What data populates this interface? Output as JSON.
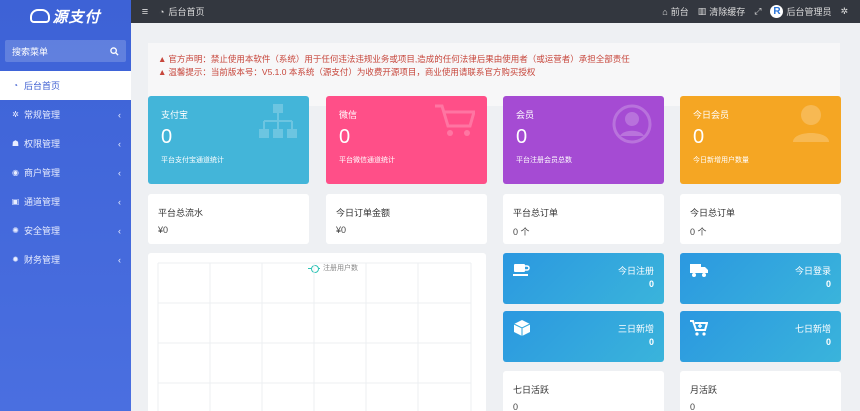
{
  "logo": {
    "text": "源支付"
  },
  "sidebar": {
    "search_label": "搜索菜单",
    "items": [
      {
        "label": "后台首页",
        "icon": "dashboard-icon",
        "active": true
      },
      {
        "label": "常规管理",
        "icon": "cogs-icon"
      },
      {
        "label": "权限管理",
        "icon": "users-icon"
      },
      {
        "label": "商户管理",
        "icon": "user-circle-icon"
      },
      {
        "label": "通道管理",
        "icon": "channel-icon"
      },
      {
        "label": "安全管理",
        "icon": "gear-icon"
      },
      {
        "label": "财务管理",
        "icon": "finance-icon"
      }
    ]
  },
  "topbar": {
    "breadcrumb": "后台首页",
    "front_label": "前台",
    "clear_cache_label": "清除缓存",
    "admin_label": "后台管理员",
    "avatar_letter": "R"
  },
  "notice": {
    "line1": "官方声明：禁止使用本软件（系统）用于任何违法违规业务或项目,造成的任何法律后果由使用者（或运营者）承担全部责任",
    "line2": "温馨提示：当前版本号：V5.1.0 本系统（源支付）为收费开源项目，商业使用请联系官方购买授权"
  },
  "cards": [
    {
      "title": "支付宝",
      "value": "0",
      "desc": "平台支付宝通道统计",
      "color": "#43b5d9",
      "icon": "sitemap-icon"
    },
    {
      "title": "微信",
      "value": "0",
      "desc": "平台微信通道统计",
      "color": "#ff4f88",
      "icon": "cart-icon"
    },
    {
      "title": "会员",
      "value": "0",
      "desc": "平台注册会员总数",
      "color": "#a54bd3",
      "icon": "user-icon"
    },
    {
      "title": "今日会员",
      "value": "0",
      "desc": "今日新增用户数量",
      "color": "#f5a623",
      "icon": "user-icon"
    }
  ],
  "stats": [
    {
      "label": "平台总流水",
      "value": "¥0"
    },
    {
      "label": "今日订单金额",
      "value": "¥0"
    },
    {
      "label": "平台总订单",
      "value": "0 个"
    },
    {
      "label": "今日总订单",
      "value": "0 个"
    }
  ],
  "chart": {
    "legend": "注册用户数"
  },
  "tiles": [
    {
      "title": "今日注册",
      "value": "0",
      "icon": "coffee-icon"
    },
    {
      "title": "今日登录",
      "value": "0",
      "icon": "truck-icon"
    },
    {
      "title": "三日新增",
      "value": "0",
      "icon": "cube-icon"
    },
    {
      "title": "七日新增",
      "value": "0",
      "icon": "cart-plus-icon"
    }
  ],
  "activity": [
    {
      "label": "七日活跃",
      "value": "0"
    },
    {
      "label": "月活跃",
      "value": "0"
    }
  ]
}
